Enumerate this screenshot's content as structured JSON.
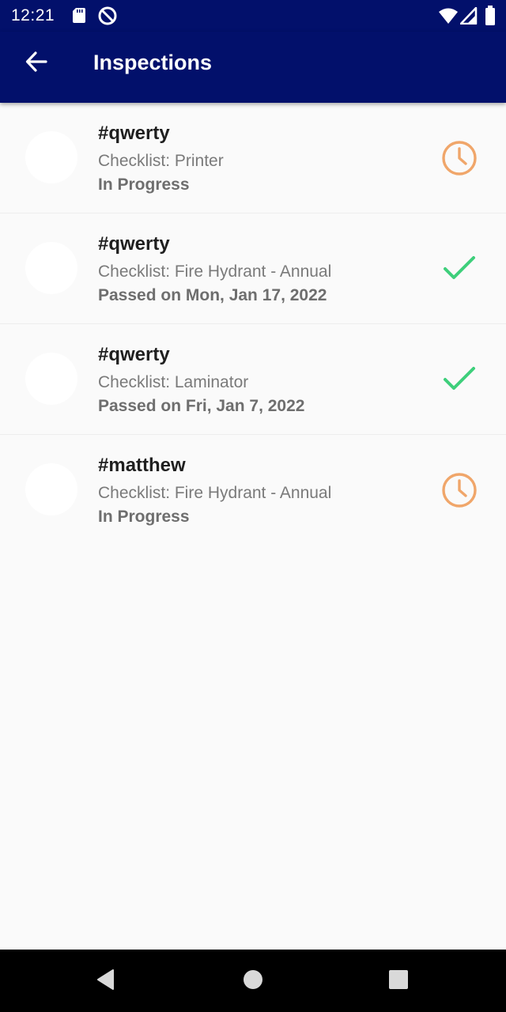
{
  "status_bar": {
    "time": "12:21",
    "icons": [
      "sd-card-icon",
      "do-not-disturb-icon",
      "wifi-icon",
      "cellular-signal-icon",
      "battery-icon"
    ]
  },
  "header": {
    "title": "Inspections",
    "back_icon": "arrow-back-icon",
    "background_color": "#02106b"
  },
  "inspections": [
    {
      "title": "#qwerty",
      "checklist": "Checklist: Printer",
      "status": "In Progress",
      "status_icon": "clock-icon",
      "status_type": "in-progress"
    },
    {
      "title": "#qwerty",
      "checklist": "Checklist: Fire Hydrant - Annual",
      "status": "Passed on Mon, Jan 17, 2022",
      "status_icon": "check-icon",
      "status_type": "passed"
    },
    {
      "title": "#qwerty",
      "checklist": "Checklist: Laminator",
      "status": "Passed on Fri, Jan 7, 2022",
      "status_icon": "check-icon",
      "status_type": "passed"
    },
    {
      "title": "#matthew",
      "checklist": "Checklist: Fire Hydrant - Annual",
      "status": "In Progress",
      "status_icon": "clock-icon",
      "status_type": "in-progress"
    }
  ],
  "colors": {
    "in_progress": "#f0a66a",
    "passed": "#3ecf7b"
  },
  "nav_bar": {
    "icons": [
      "back-triangle-icon",
      "home-circle-icon",
      "recents-square-icon"
    ]
  }
}
